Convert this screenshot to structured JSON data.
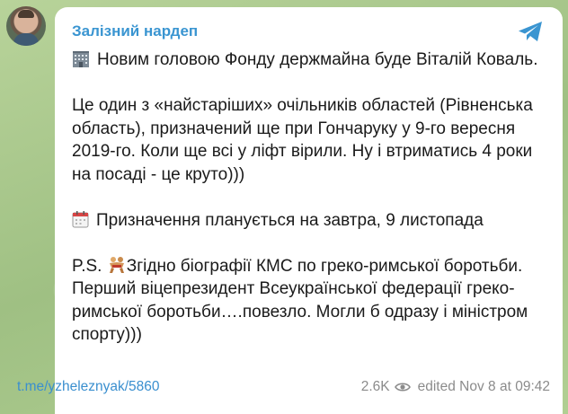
{
  "channel": {
    "name": "Залізний нардеп"
  },
  "message": {
    "line1": "Новим головою Фонду держмайна буде Віталій Коваль.",
    "para2": "Це один з «найстаріших» очільників областей (Рівненська область), призначений ще при Гончаруку у 9-го вересня 2019-го. Коли ще всі у ліфт вірили. Ну і втриматись 4 роки на посаді - це круто)))",
    "para3": "Призначення планується на завтра, 9 листопада",
    "ps_prefix": "P.S.",
    "ps_text": "Згідно біографії КМС по греко-римської боротьби. Перший віцепрезидент Всеукраїнської федерації греко-римської боротьби….повезло. Могли б одразу і міністром спорту)))"
  },
  "footer": {
    "link": "t.me/yzheleznyak/5860",
    "views": "2.6K",
    "edited": "edited",
    "datetime": "Nov 8 at 09:42"
  },
  "icons": {
    "building": "office-building-icon",
    "calendar": "calendar-icon",
    "wrestling": "wrestling-icon",
    "views": "eye-icon",
    "app": "telegram-icon"
  },
  "colors": {
    "accent": "#3a95d1",
    "link": "#3a8fcf",
    "meta": "#8b8b8b",
    "text": "#1a1a1a",
    "background": "#a9c78f"
  }
}
